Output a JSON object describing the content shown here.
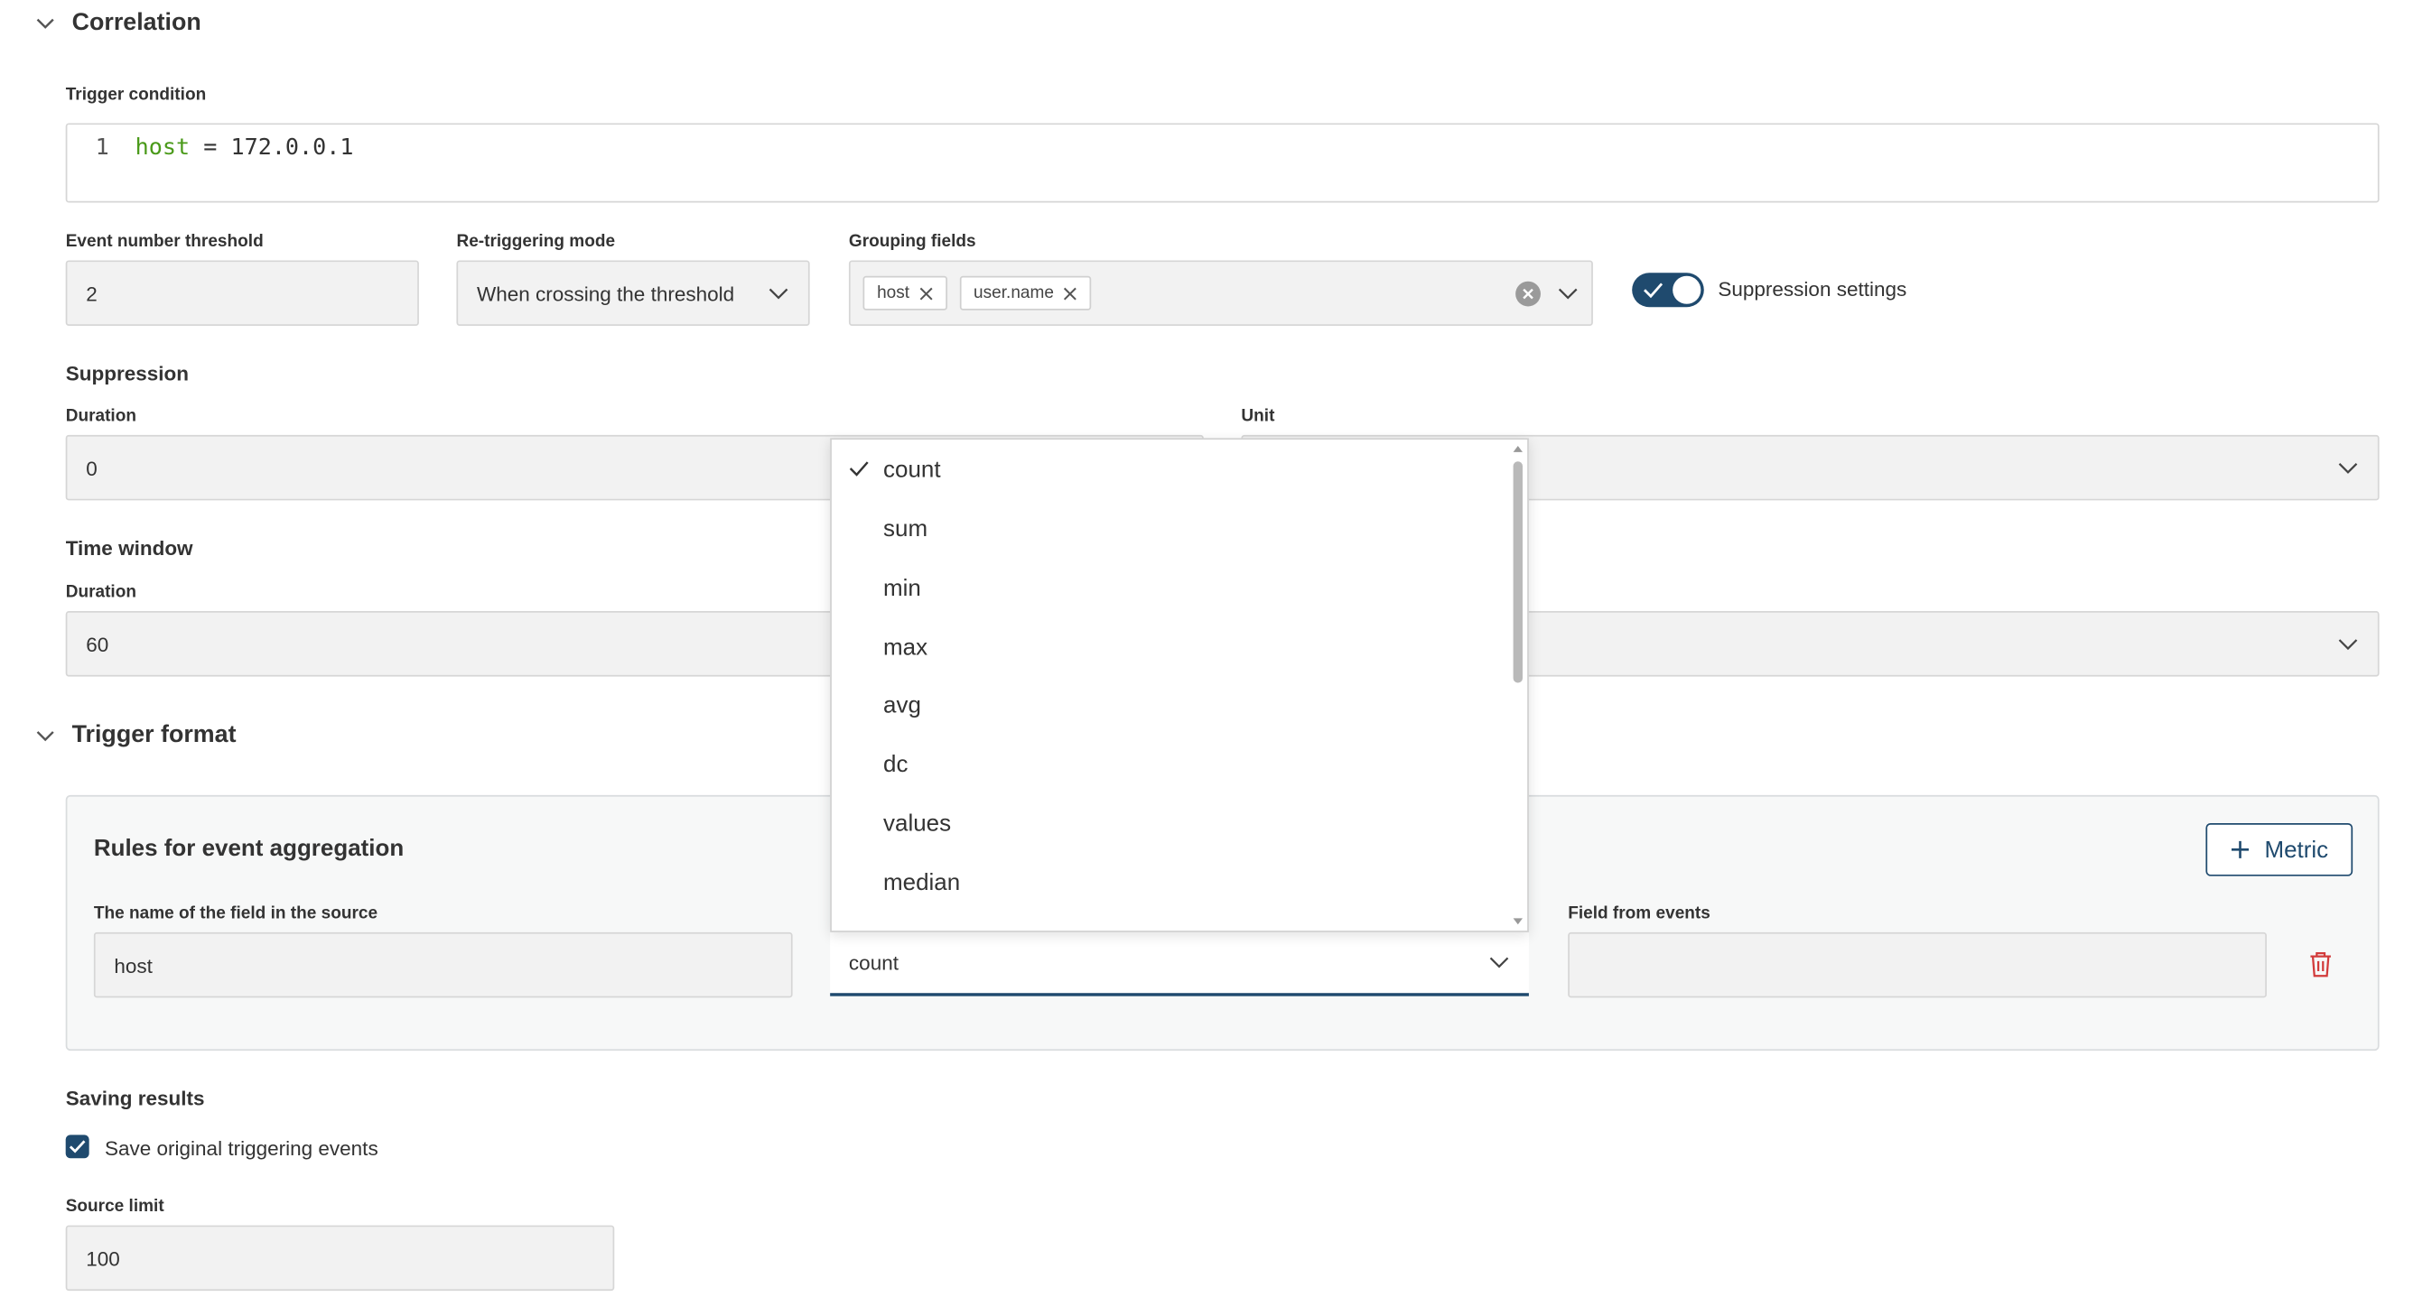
{
  "correlation": {
    "title": "Correlation",
    "trigger_condition_label": "Trigger condition",
    "code": {
      "line_number": "1",
      "field": "host",
      "operator": "=",
      "value": "172.0.0.1"
    },
    "event_threshold": {
      "label": "Event number threshold",
      "value": "2"
    },
    "retriggering": {
      "label": "Re-triggering mode",
      "value": "When crossing the threshold"
    },
    "grouping": {
      "label": "Grouping fields",
      "chips": [
        "host",
        "user.name"
      ]
    },
    "suppression_toggle": {
      "label": "Suppression settings",
      "on": true
    },
    "suppression": {
      "title": "Suppression",
      "duration_label": "Duration",
      "duration_value": "0",
      "unit_label": "Unit"
    },
    "time_window": {
      "title": "Time window",
      "duration_label": "Duration",
      "duration_value": "60"
    }
  },
  "trigger_format": {
    "title": "Trigger format",
    "rules_title": "Rules for event aggregation",
    "metric_button": "Metric",
    "source_field_label": "The name of the field in the source",
    "source_field_value": "host",
    "aggregation_value": "count",
    "field_from_events_label": "Field from events",
    "field_from_events_value": ""
  },
  "dropdown": {
    "selected": "count",
    "options": [
      "count",
      "sum",
      "min",
      "max",
      "avg",
      "dc",
      "values",
      "median"
    ]
  },
  "saving": {
    "title": "Saving results",
    "checkbox_label": "Save original triggering events",
    "checked": true,
    "source_limit_label": "Source limit",
    "source_limit_value": "100"
  },
  "colors": {
    "accent": "#1f4a6e",
    "code_green": "#4a9a1a",
    "delete_red": "#d23b3b"
  },
  "icons": [
    "chevron-down-icon",
    "close-icon",
    "clear-circle-icon",
    "check-icon",
    "plus-icon",
    "trash-icon"
  ]
}
